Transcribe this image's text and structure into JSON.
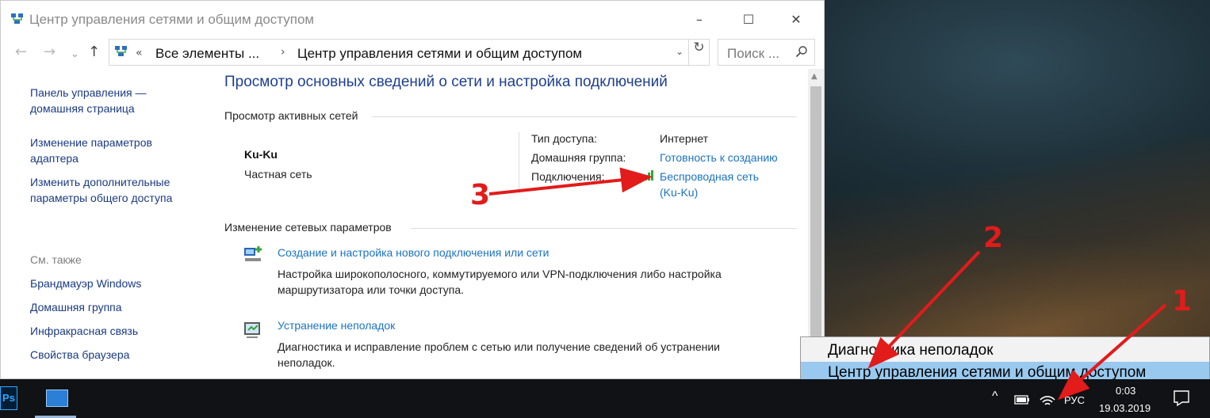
{
  "window": {
    "title": "Центр управления сетями и общим доступом",
    "controls": {
      "minimize": "–",
      "maximize": "☐",
      "close": "✕"
    }
  },
  "address_bar": {
    "overflow": "«",
    "crumbs": [
      "Все элементы ...",
      "Центр управления сетями и общим доступом"
    ],
    "separator": "›",
    "dropdown": "⌄",
    "search_placeholder": "Поиск ..."
  },
  "nav": {
    "back": "←",
    "forward": "→",
    "recent": "⌄",
    "up": "↑",
    "refresh": "↻"
  },
  "sidebar": {
    "home": [
      "Панель управления —",
      "домашняя страница"
    ],
    "adapter": [
      "Изменение параметров",
      "адаптера"
    ],
    "sharing": [
      "Изменить дополнительные",
      "параметры общего доступа"
    ],
    "see_also": "См. также",
    "links": [
      "Брандмауэр Windows",
      "Домашняя группа",
      "Инфракрасная связь",
      "Свойства браузера"
    ]
  },
  "main": {
    "title": "Просмотр основных сведений о сети и настройка подключений",
    "active_networks": "Просмотр активных сетей",
    "network": {
      "name": "Ku-Ku",
      "type": "Частная сеть"
    },
    "props": {
      "access_label": "Тип доступа:",
      "access_value": "Интернет",
      "homegroup_label": "Домашняя группа:",
      "homegroup_value": "Готовность к созданию",
      "connections_label": "Подключения:",
      "connection_line1": "Беспроводная сеть",
      "connection_line2": "(Ku-Ku)"
    },
    "change_settings": "Изменение сетевых параметров",
    "tasks": [
      {
        "link": "Создание и настройка нового подключения или сети",
        "desc1": "Настройка широкополосного, коммутируемого или VPN-подключения либо настройка",
        "desc2": "маршрутизатора или точки доступа."
      },
      {
        "link": "Устранение неполадок",
        "desc1": "Диагностика и исправление проблем с сетью или получение сведений об устранении",
        "desc2": "неполадок."
      }
    ]
  },
  "context_menu": {
    "items": [
      "Диагностика неполадок",
      "Центр управления сетями и общим доступом"
    ],
    "selected_index": 1
  },
  "taskbar": {
    "ps_label": "Ps",
    "tray_chevron": "^",
    "language": "РУС",
    "time": "0:03",
    "date": "19.03.2019"
  },
  "annotations": {
    "one": "1",
    "two": "2",
    "three": "3"
  },
  "colors": {
    "annotation_red": "#e21b1b",
    "link_blue": "#1a73c2",
    "title_blue": "#1e3f90",
    "menu_highlight": "#99c9ef"
  }
}
